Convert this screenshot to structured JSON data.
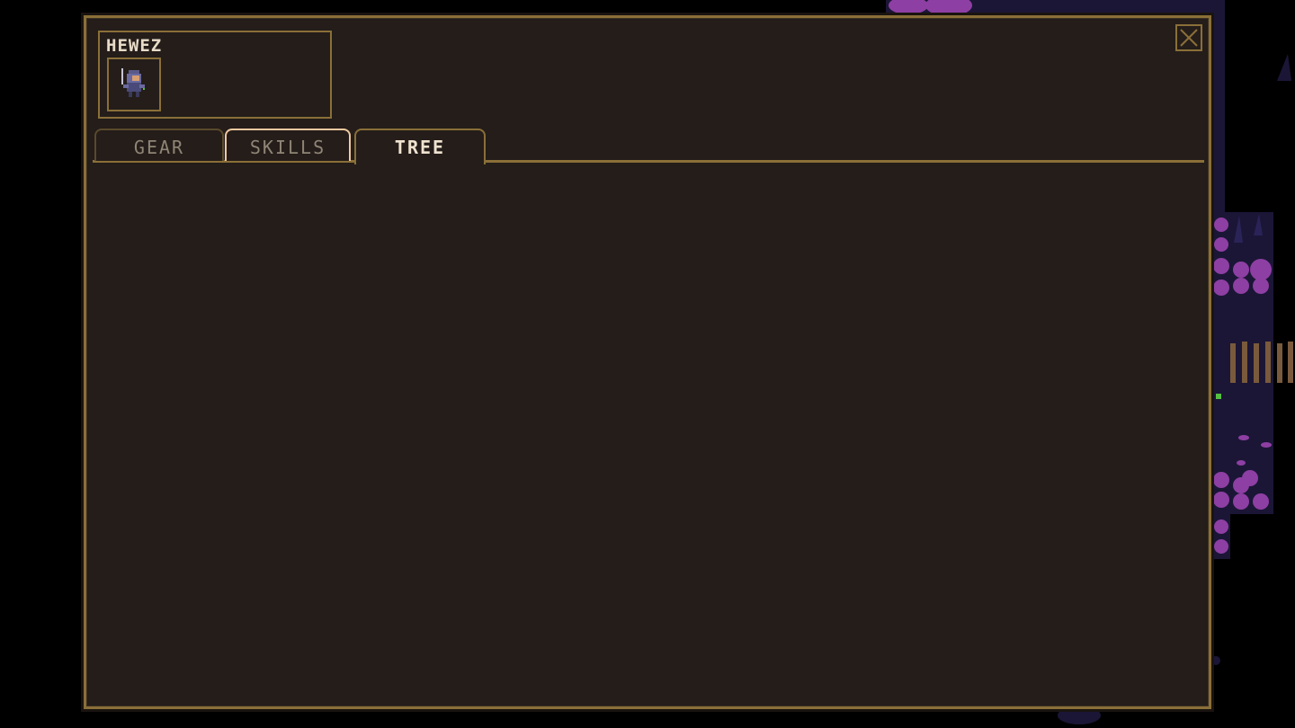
{
  "character": {
    "name": "HEWEZ"
  },
  "tabs": [
    {
      "label": "GEAR",
      "state": "inactive"
    },
    {
      "label": "SKILLS",
      "state": "hover"
    },
    {
      "label": "TREE",
      "state": "active"
    }
  ],
  "colors": {
    "panel_bg": "#241d1a",
    "border_gold": "#8a6f38",
    "text_light": "#efe3cf",
    "text_dim": "#8f8575",
    "tab_hover": "#f0c8a0",
    "world_purple": "#8e3fa3",
    "world_night": "#1b1636",
    "bridge_brown": "#7a5a3c",
    "sprite_green": "#55c040"
  },
  "icons": {
    "close": "close-x-icon",
    "portrait": "character-sprite-icon"
  }
}
